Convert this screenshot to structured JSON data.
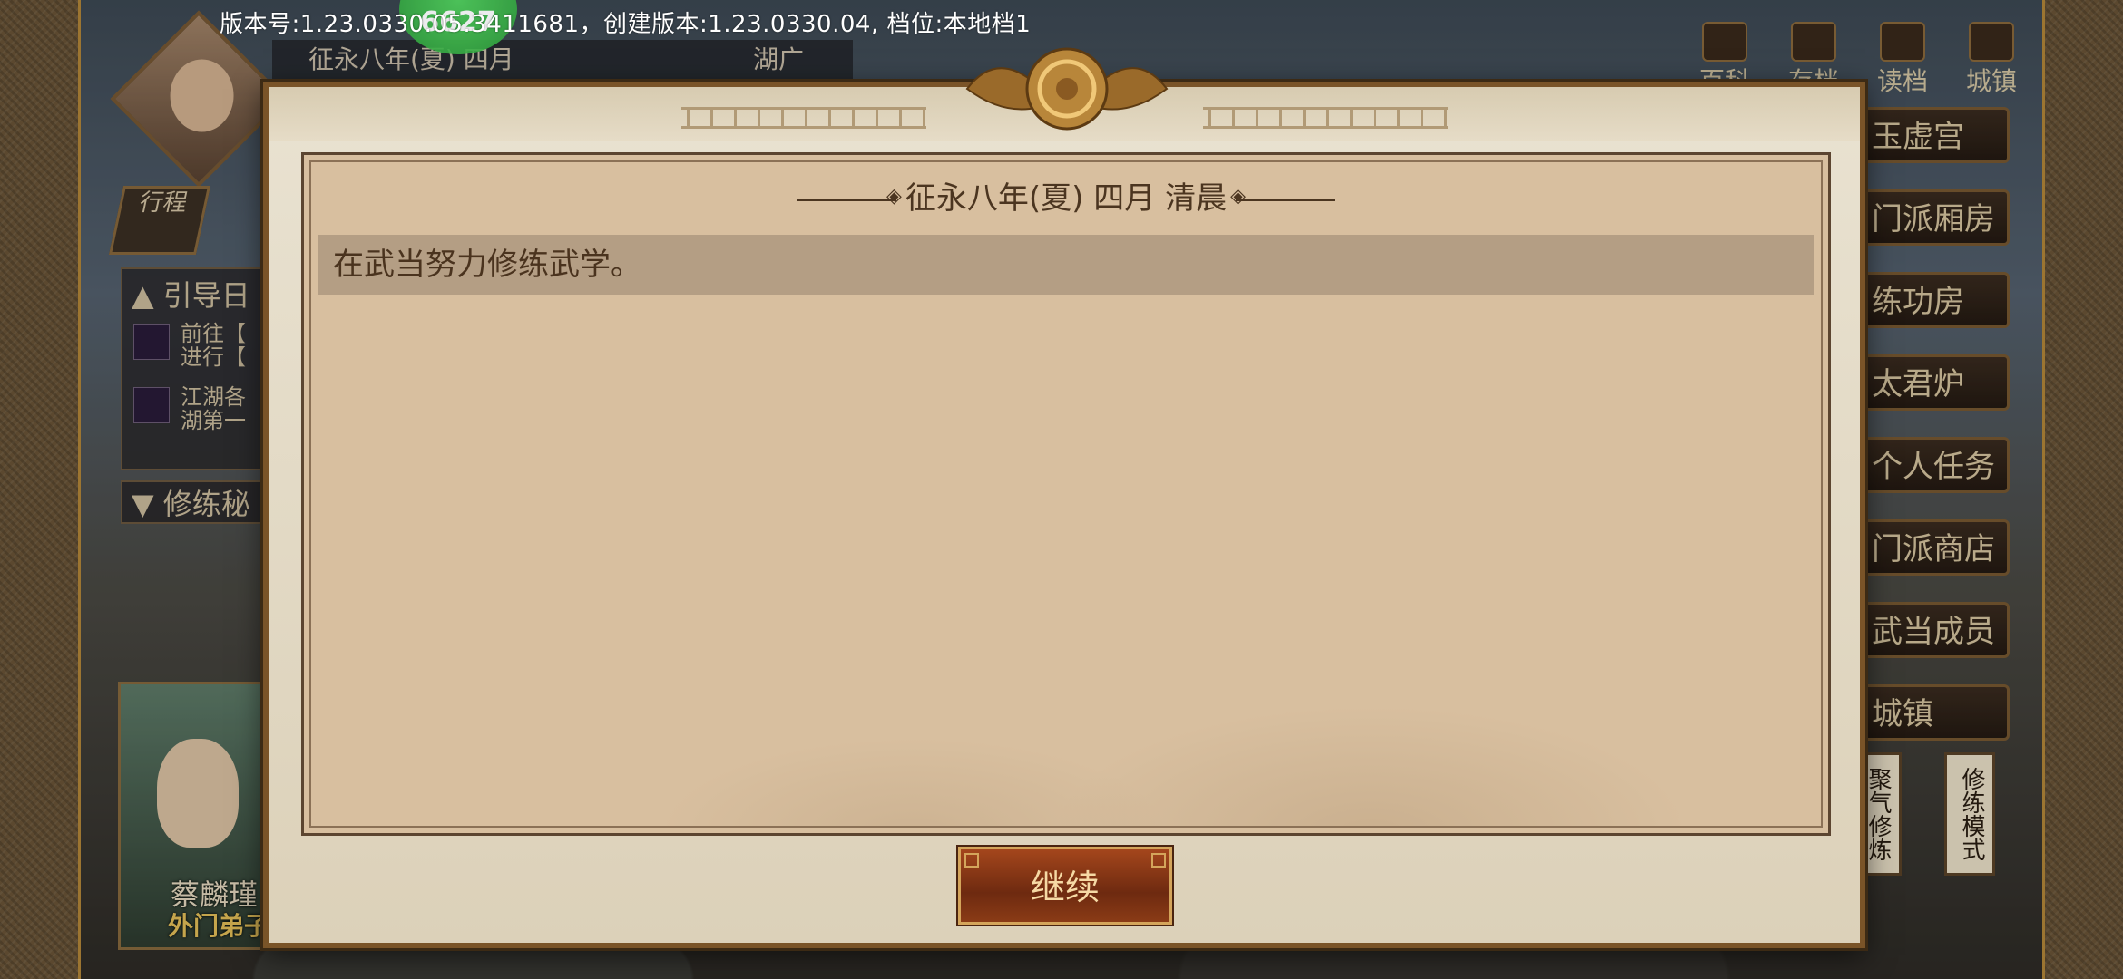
{
  "top_info": "版本号:1.23.0330.05.3411681，创建版本:1.23.0330.04, 档位:本地档1",
  "badge": "6627",
  "header": {
    "date": "征永八年(夏) 四月",
    "region": "湖广"
  },
  "left": {
    "xingcheng": "行程",
    "guide_title": "引导日",
    "guide_items": [
      {
        "line1": "前往【",
        "line2": "进行【"
      },
      {
        "line1": "江湖各",
        "line2": "湖第一"
      }
    ],
    "xiulian_tab": "修练秘",
    "char_name": "蔡麟瑾",
    "char_rank": "外门弟子"
  },
  "top_icons": [
    "百科",
    "存档",
    "读档",
    "城镇"
  ],
  "right_menu": [
    "玉虚宫",
    "门派厢房",
    "练功房",
    "太君炉",
    "个人任务",
    "门派商店",
    "武当成员",
    "城镇"
  ],
  "vertical_buttons": [
    "聚气修炼",
    "修练模式"
  ],
  "modal": {
    "date_title": "征永八年(夏) 四月 清晨",
    "log": [
      "在武当努力修练武学。"
    ],
    "continue_label": "继续"
  }
}
